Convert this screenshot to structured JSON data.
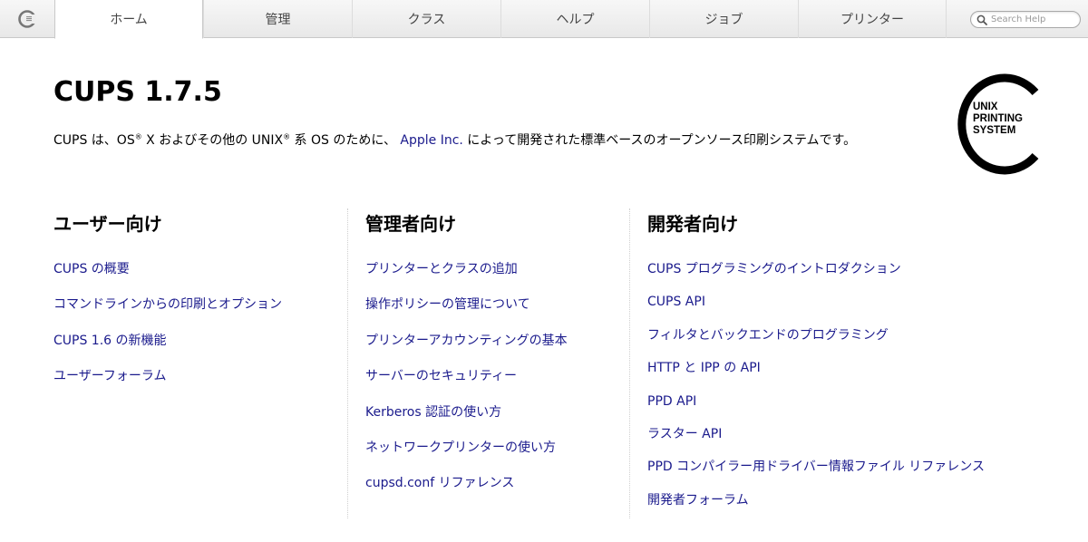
{
  "nav": {
    "tabs": [
      {
        "label": "ホーム",
        "active": true
      },
      {
        "label": "管理",
        "active": false
      },
      {
        "label": "クラス",
        "active": false
      },
      {
        "label": "ヘルプ",
        "active": false
      },
      {
        "label": "ジョブ",
        "active": false
      },
      {
        "label": "プリンター",
        "active": false
      }
    ],
    "search": {
      "placeholder": "Search Help"
    }
  },
  "header": {
    "title": "CUPS 1.7.5",
    "intro": {
      "part1": "CUPS は、OS",
      "reg1": "®",
      "part2": " X およびその他の UNIX",
      "reg2": "®",
      "part3": " 系 OS のために、 ",
      "link": "Apple Inc.",
      "part4": " によって開発された標準ベースのオープンソース印刷システムです。"
    },
    "logo_text": [
      "UNIX",
      "PRINTING",
      "SYSTEM"
    ]
  },
  "columns": {
    "user": {
      "heading": "ユーザー向け",
      "links": [
        "CUPS の概要",
        "コマンドラインからの印刷とオプション",
        "CUPS 1.6 の新機能",
        "ユーザーフォーラム"
      ]
    },
    "admin": {
      "heading": "管理者向け",
      "links": [
        "プリンターとクラスの追加",
        "操作ポリシーの管理について",
        "プリンターアカウンティングの基本",
        "サーバーのセキュリティー",
        "Kerberos 認証の使い方",
        "ネットワークプリンターの使い方",
        "cupsd.conf リファレンス"
      ]
    },
    "dev": {
      "heading": "開発者向け",
      "links": [
        "CUPS プログラミングのイントロダクション",
        "CUPS API",
        "フィルタとバックエンドのプログラミング",
        "HTTP と IPP の API",
        "PPD API",
        "ラスター API",
        "PPD コンパイラー用ドライバー情報ファイル リファレンス",
        "開発者フォーラム"
      ]
    }
  },
  "colors": {
    "link": "#1a1a8c",
    "text": "#000000"
  }
}
